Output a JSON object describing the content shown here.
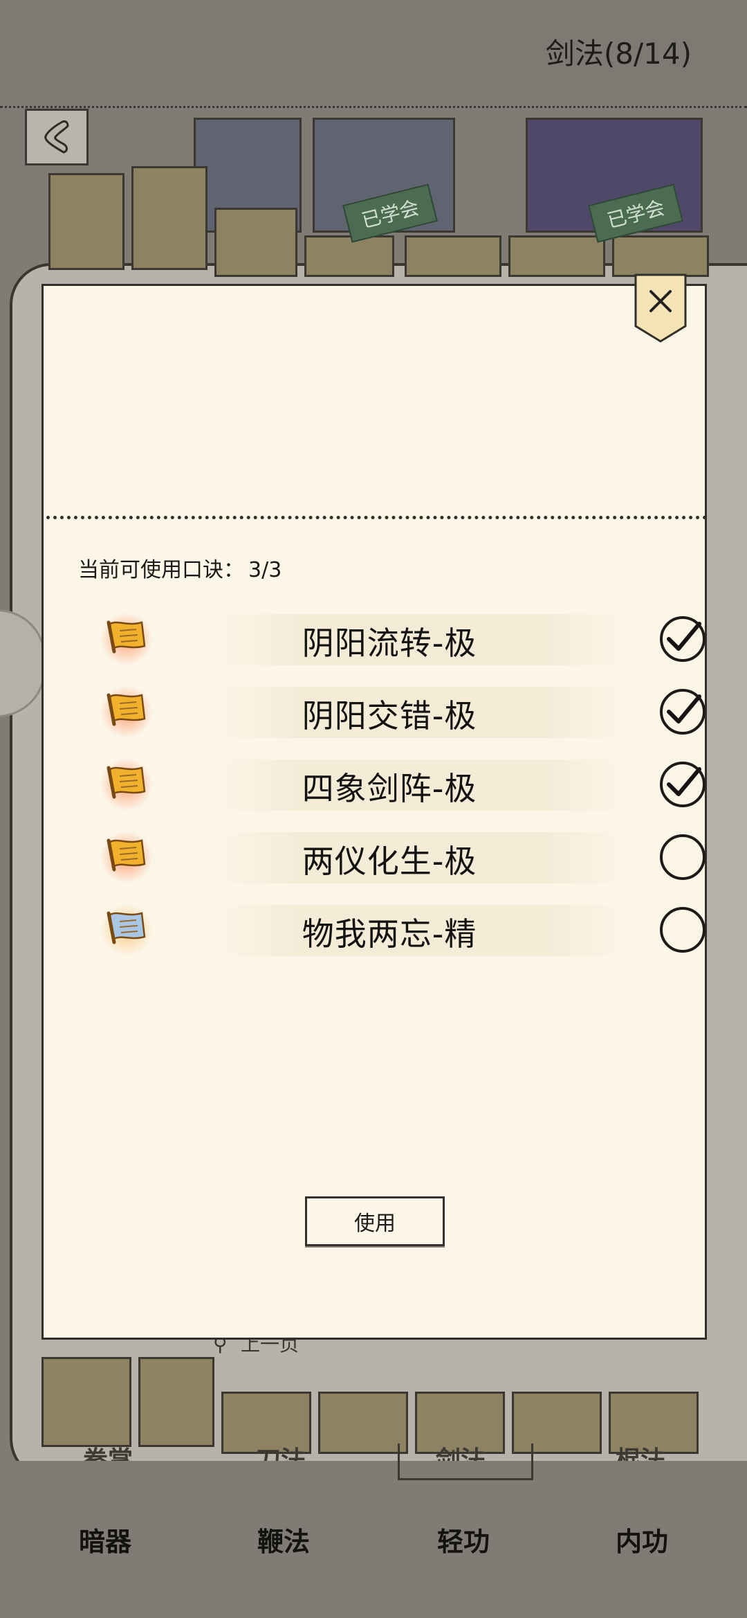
{
  "header": {
    "title": "剑法(8/14)"
  },
  "background": {
    "learned_stamp": "已学会",
    "prev_page": "上一页",
    "ghost_tabs": [
      "拳掌",
      "刀法",
      "剑法",
      "棍法"
    ]
  },
  "dialog": {
    "quota_label": "当前可使用口诀：",
    "quota_value": "3/3",
    "techniques": [
      {
        "name": "阴阳流转-极",
        "icon": "gold-scroll-icon",
        "checked": true
      },
      {
        "name": "阴阳交错-极",
        "icon": "gold-scroll-icon",
        "checked": true
      },
      {
        "name": "四象剑阵-极",
        "icon": "gold-scroll-icon",
        "checked": true
      },
      {
        "name": "两仪化生-极",
        "icon": "gold-scroll-icon",
        "checked": false
      },
      {
        "name": "物我两忘-精",
        "icon": "blue-scroll-icon",
        "checked": false
      }
    ],
    "use_button": "使用"
  },
  "bottom_tabs": [
    "暗器",
    "鞭法",
    "轻功",
    "内功"
  ],
  "colors": {
    "overlay": "#7f7c76",
    "paper": "#fcf6e8",
    "ink": "#141311",
    "gold_scroll": "#f2b12d",
    "blue_scroll": "#a9c6e4"
  }
}
